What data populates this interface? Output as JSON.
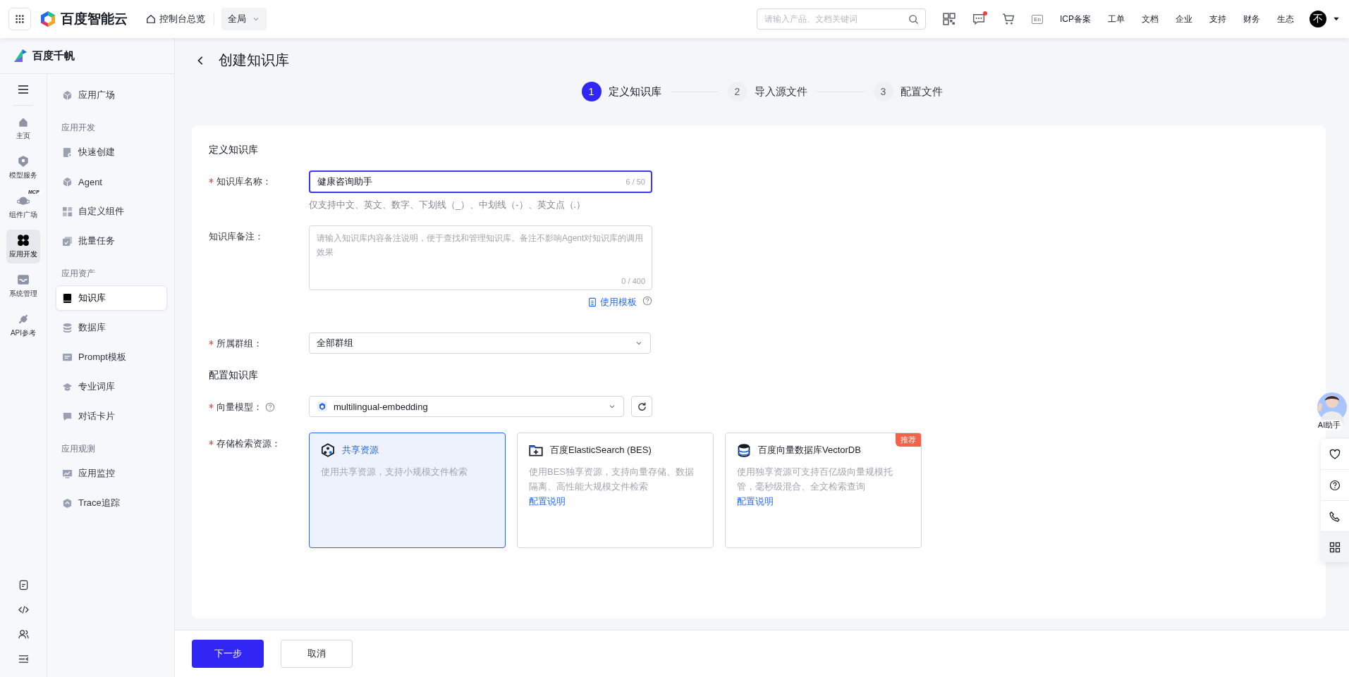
{
  "topbar": {
    "brand": "百度智能云",
    "console": "控制台总览",
    "scope": "全局",
    "search": {
      "placeholder": "请输入产品、文档关键词"
    },
    "tools": [
      {
        "kind": "qr"
      },
      {
        "kind": "message",
        "unread": true
      },
      {
        "kind": "cart"
      },
      {
        "kind": "lang",
        "label": "En"
      }
    ],
    "links": [
      "ICP备案",
      "工单",
      "文档",
      "企业",
      "支持",
      "财务",
      "生态"
    ],
    "avatar": "不"
  },
  "sidebar": {
    "brand": "百度千帆",
    "rail": [
      {
        "kind": "home",
        "label": "主页",
        "selected": false
      },
      {
        "kind": "model",
        "label": "模型服务",
        "selected": false
      },
      {
        "kind": "planet",
        "label": "组件广场",
        "tag": "MCP",
        "selected": false
      },
      {
        "kind": "apps",
        "label": "应用开发",
        "selected": true
      },
      {
        "kind": "inbox",
        "label": "系统管理",
        "selected": false
      },
      {
        "kind": "plug",
        "label": "API参考",
        "selected": false
      }
    ],
    "nav": [
      {
        "items": [
          {
            "kind": "cube",
            "label": "应用广场",
            "selected": false
          }
        ]
      },
      {
        "title": "应用开发",
        "items": [
          {
            "kind": "doc",
            "label": "快速创建",
            "selected": false
          },
          {
            "kind": "cube",
            "label": "Agent",
            "selected": false
          },
          {
            "kind": "puzzle",
            "label": "自定义组件",
            "selected": false
          },
          {
            "kind": "tasks",
            "label": "批量任务",
            "selected": false
          }
        ]
      },
      {
        "title": "应用资产",
        "items": [
          {
            "kind": "book",
            "label": "知识库",
            "selected": true
          },
          {
            "kind": "db",
            "label": "数据库",
            "selected": false
          },
          {
            "kind": "prompt",
            "label": "Prompt模板",
            "selected": false
          },
          {
            "kind": "grad",
            "label": "专业词库",
            "selected": false
          },
          {
            "kind": "chat",
            "label": "对话卡片",
            "selected": false
          }
        ]
      },
      {
        "title": "应用观测",
        "items": [
          {
            "kind": "chart",
            "label": "应用监控",
            "selected": false
          },
          {
            "kind": "trace",
            "label": "Trace追踪",
            "selected": false
          }
        ]
      }
    ]
  },
  "page": {
    "title": "创建知识库",
    "steps": [
      {
        "number": "1",
        "label": "定义知识库",
        "selected": true
      },
      {
        "number": "2",
        "label": "导入源文件",
        "selected": false
      },
      {
        "number": "3",
        "label": "配置文件",
        "selected": false
      }
    ],
    "sections": [
      {
        "title": "定义知识库",
        "fields": [
          {
            "kind": "input",
            "label": "知识库名称：",
            "required": true,
            "focused": true,
            "value": "健康咨询助手",
            "counter": "6 / 50",
            "hint": "仅支持中文、英文、数字、下划线（_）、中划线（-）、英文点（.）"
          },
          {
            "kind": "textarea",
            "label": "知识库备注：",
            "required": false,
            "placeholder": "请输入知识库内容备注说明，便于查找和管理知识库。备注不影响Agent对知识库的调用效果",
            "counter": "0 / 400",
            "link": "使用模板"
          },
          {
            "kind": "select",
            "label": "所属群组：",
            "required": true,
            "value": "全部群组"
          }
        ]
      },
      {
        "title": "配置知识库",
        "fields": [
          {
            "kind": "model",
            "label": "向量模型：",
            "required": true,
            "help": true,
            "value": "multilingual-embedding"
          },
          {
            "kind": "cards",
            "label": "存储检索资源：",
            "required": true,
            "options": [
              {
                "title": "共享资源",
                "desc": "使用共享资源，支持小规模文件检索",
                "selected": true
              },
              {
                "title": "百度ElasticSearch (BES)",
                "desc": "使用BES独享资源，支持向量存储、数据隔离、高性能大规模文件检索",
                "link": "配置说明",
                "selected": false
              },
              {
                "title": "百度向量数据库VectorDB",
                "desc": "使用独享资源可支持百亿级向量规模托管，毫秒级混合、全文检索查询",
                "link": "配置说明",
                "badge": "推荐",
                "selected": false
              }
            ]
          }
        ]
      }
    ],
    "buttons": [
      {
        "kind": "primary",
        "label": "下一步"
      },
      {
        "kind": "default",
        "label": "取消"
      }
    ]
  },
  "float": {
    "assistant": "AI助手",
    "tools": [
      {
        "kind": "heart"
      },
      {
        "kind": "help"
      },
      {
        "kind": "phone"
      },
      {
        "kind": "grid"
      }
    ]
  }
}
